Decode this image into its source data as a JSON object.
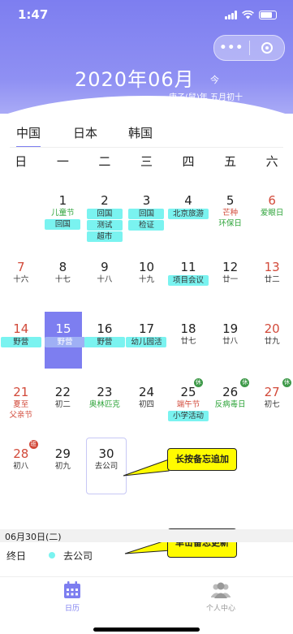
{
  "status": {
    "time": "1:47"
  },
  "header": {
    "title": "2020年06月",
    "today_label": "今",
    "lunar_info": "庚子(鼠)年 五月初十",
    "capsule_dots": "•••"
  },
  "tabs": [
    {
      "label": "中国"
    },
    {
      "label": "日本"
    },
    {
      "label": "韩国"
    }
  ],
  "weekdays": [
    "日",
    "一",
    "二",
    "三",
    "四",
    "五",
    "六"
  ],
  "days": [
    {
      "n": "1",
      "sub": "儿童节",
      "memos": [
        "回国"
      ]
    },
    {
      "n": "2",
      "sub": "回国",
      "memos": [
        "测试",
        "超市"
      ]
    },
    {
      "n": "3",
      "sub": "回国",
      "memos": [
        "检证"
      ]
    },
    {
      "n": "4",
      "sub": "北京旅游",
      "memos": []
    },
    {
      "n": "5",
      "sub": "芒种",
      "sub2": "环保日",
      "memos": []
    },
    {
      "n": "6",
      "sub": "爱眼日",
      "memos": []
    },
    {
      "n": "7",
      "sub": "十六",
      "memos": []
    },
    {
      "n": "8",
      "sub": "十七",
      "memos": []
    },
    {
      "n": "9",
      "sub": "十八",
      "memos": []
    },
    {
      "n": "10",
      "sub": "十九",
      "memos": []
    },
    {
      "n": "11",
      "sub": "项目会议",
      "memos": []
    },
    {
      "n": "12",
      "sub": "廿一",
      "memos": []
    },
    {
      "n": "13",
      "sub": "廿二",
      "memos": []
    },
    {
      "n": "14",
      "sub": "野营",
      "memos": []
    },
    {
      "n": "15",
      "sub": "野营",
      "memos": []
    },
    {
      "n": "16",
      "sub": "野营",
      "memos": []
    },
    {
      "n": "17",
      "sub": "幼儿园活",
      "memos": []
    },
    {
      "n": "18",
      "sub": "廿七",
      "memos": []
    },
    {
      "n": "19",
      "sub": "廿八",
      "memos": []
    },
    {
      "n": "20",
      "sub": "廿九",
      "memos": []
    },
    {
      "n": "21",
      "sub": "夏至",
      "sub2": "父亲节",
      "memos": []
    },
    {
      "n": "22",
      "sub": "初二",
      "memos": []
    },
    {
      "n": "23",
      "sub": "奥林匹克",
      "memos": []
    },
    {
      "n": "24",
      "sub": "初四",
      "memos": []
    },
    {
      "n": "25",
      "sub": "端午节",
      "memos": [
        "小学活动"
      ],
      "badge": "休"
    },
    {
      "n": "26",
      "sub": "反病毒日",
      "memos": [],
      "badge": "休"
    },
    {
      "n": "27",
      "sub": "初七",
      "memos": [],
      "badge": "休"
    },
    {
      "n": "28",
      "sub": "初八",
      "memos": [],
      "badge": "班"
    },
    {
      "n": "29",
      "sub": "初九",
      "memos": []
    },
    {
      "n": "30",
      "sub": "去公司",
      "memos": []
    }
  ],
  "tips": {
    "long_press": "长按备忘追加",
    "single_click": "单击备忘更新"
  },
  "selected": {
    "date_label": "06月30日(二)",
    "all_day": "终日",
    "event": "去公司"
  },
  "tabbar": [
    {
      "label": "日历",
      "icon": "calendar-icon"
    },
    {
      "label": "个人中心",
      "icon": "people-icon"
    }
  ],
  "colors": {
    "accent": "#7d7ef0",
    "memo": "#7af3f0",
    "holiday_red": "#d24a3a",
    "festival_green": "#2ea43a",
    "tip_yellow": "#fffb00"
  }
}
